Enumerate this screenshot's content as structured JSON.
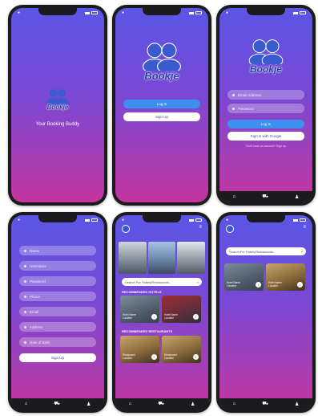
{
  "brand": {
    "name": "Bookje",
    "tagline": "Your Booking Buddy"
  },
  "login": {
    "login_label": "Log In",
    "signup_label": "Sign Up"
  },
  "login_form": {
    "email_placeholder": "Email Address",
    "password_placeholder": "Password",
    "login_label": "Log In",
    "google_label": "Sign in with Google",
    "signup_prompt": "Don't have an account? Sign up"
  },
  "signup_form": {
    "fields": [
      "Name",
      "Username",
      "Password",
      "Phone",
      "Email",
      "Address",
      "Date of Birth"
    ],
    "signup_label": "Sign Up"
  },
  "home": {
    "search_placeholder": "Search For Hotels/Restaurants...",
    "section_hotels": "RECOMMENDED HOTELS",
    "section_restaurants": "RECOMMENDED RESTAURANTS",
    "hotels": [
      {
        "name": "Hotel Name",
        "location": "Location"
      },
      {
        "name": "Hotel Name",
        "location": "Location"
      }
    ],
    "restaurants": [
      {
        "name": "Restaurant",
        "location": "Location"
      },
      {
        "name": "Restaurant",
        "location": "Location"
      }
    ]
  },
  "results": {
    "search_placeholder": "Search For Hotels/Restaurants...",
    "items": [
      {
        "name": "Hotel Name",
        "location": "Location"
      },
      {
        "name": "Hotel Name",
        "location": "Location"
      }
    ]
  },
  "nav": {
    "home_icon": "home-icon",
    "cart_icon": "cart-icon",
    "profile_icon": "profile-icon"
  },
  "colors": {
    "accent": "#3d8ff0",
    "gradient_top": "#5a56e6",
    "gradient_bottom": "#c3349e",
    "frame": "#1b1b1d"
  }
}
